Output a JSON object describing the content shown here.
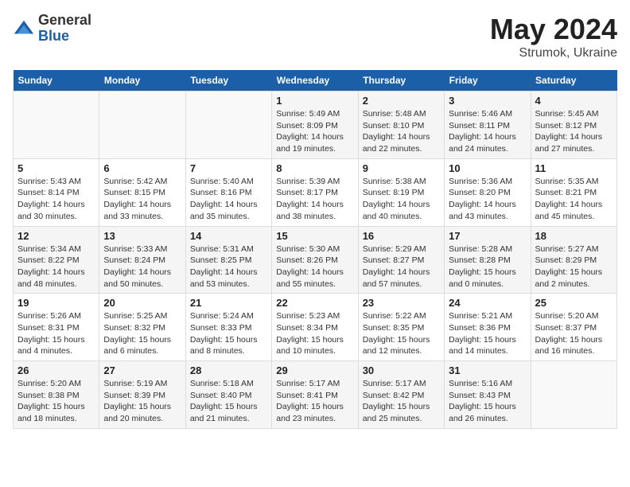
{
  "logo": {
    "general": "General",
    "blue": "Blue"
  },
  "title": {
    "month_year": "May 2024",
    "location": "Strumok, Ukraine"
  },
  "weekdays": [
    "Sunday",
    "Monday",
    "Tuesday",
    "Wednesday",
    "Thursday",
    "Friday",
    "Saturday"
  ],
  "weeks": [
    [
      {
        "day": "",
        "info": ""
      },
      {
        "day": "",
        "info": ""
      },
      {
        "day": "",
        "info": ""
      },
      {
        "day": "1",
        "info": "Sunrise: 5:49 AM\nSunset: 8:09 PM\nDaylight: 14 hours\nand 19 minutes."
      },
      {
        "day": "2",
        "info": "Sunrise: 5:48 AM\nSunset: 8:10 PM\nDaylight: 14 hours\nand 22 minutes."
      },
      {
        "day": "3",
        "info": "Sunrise: 5:46 AM\nSunset: 8:11 PM\nDaylight: 14 hours\nand 24 minutes."
      },
      {
        "day": "4",
        "info": "Sunrise: 5:45 AM\nSunset: 8:12 PM\nDaylight: 14 hours\nand 27 minutes."
      }
    ],
    [
      {
        "day": "5",
        "info": "Sunrise: 5:43 AM\nSunset: 8:14 PM\nDaylight: 14 hours\nand 30 minutes."
      },
      {
        "day": "6",
        "info": "Sunrise: 5:42 AM\nSunset: 8:15 PM\nDaylight: 14 hours\nand 33 minutes."
      },
      {
        "day": "7",
        "info": "Sunrise: 5:40 AM\nSunset: 8:16 PM\nDaylight: 14 hours\nand 35 minutes."
      },
      {
        "day": "8",
        "info": "Sunrise: 5:39 AM\nSunset: 8:17 PM\nDaylight: 14 hours\nand 38 minutes."
      },
      {
        "day": "9",
        "info": "Sunrise: 5:38 AM\nSunset: 8:19 PM\nDaylight: 14 hours\nand 40 minutes."
      },
      {
        "day": "10",
        "info": "Sunrise: 5:36 AM\nSunset: 8:20 PM\nDaylight: 14 hours\nand 43 minutes."
      },
      {
        "day": "11",
        "info": "Sunrise: 5:35 AM\nSunset: 8:21 PM\nDaylight: 14 hours\nand 45 minutes."
      }
    ],
    [
      {
        "day": "12",
        "info": "Sunrise: 5:34 AM\nSunset: 8:22 PM\nDaylight: 14 hours\nand 48 minutes."
      },
      {
        "day": "13",
        "info": "Sunrise: 5:33 AM\nSunset: 8:24 PM\nDaylight: 14 hours\nand 50 minutes."
      },
      {
        "day": "14",
        "info": "Sunrise: 5:31 AM\nSunset: 8:25 PM\nDaylight: 14 hours\nand 53 minutes."
      },
      {
        "day": "15",
        "info": "Sunrise: 5:30 AM\nSunset: 8:26 PM\nDaylight: 14 hours\nand 55 minutes."
      },
      {
        "day": "16",
        "info": "Sunrise: 5:29 AM\nSunset: 8:27 PM\nDaylight: 14 hours\nand 57 minutes."
      },
      {
        "day": "17",
        "info": "Sunrise: 5:28 AM\nSunset: 8:28 PM\nDaylight: 15 hours\nand 0 minutes."
      },
      {
        "day": "18",
        "info": "Sunrise: 5:27 AM\nSunset: 8:29 PM\nDaylight: 15 hours\nand 2 minutes."
      }
    ],
    [
      {
        "day": "19",
        "info": "Sunrise: 5:26 AM\nSunset: 8:31 PM\nDaylight: 15 hours\nand 4 minutes."
      },
      {
        "day": "20",
        "info": "Sunrise: 5:25 AM\nSunset: 8:32 PM\nDaylight: 15 hours\nand 6 minutes."
      },
      {
        "day": "21",
        "info": "Sunrise: 5:24 AM\nSunset: 8:33 PM\nDaylight: 15 hours\nand 8 minutes."
      },
      {
        "day": "22",
        "info": "Sunrise: 5:23 AM\nSunset: 8:34 PM\nDaylight: 15 hours\nand 10 minutes."
      },
      {
        "day": "23",
        "info": "Sunrise: 5:22 AM\nSunset: 8:35 PM\nDaylight: 15 hours\nand 12 minutes."
      },
      {
        "day": "24",
        "info": "Sunrise: 5:21 AM\nSunset: 8:36 PM\nDaylight: 15 hours\nand 14 minutes."
      },
      {
        "day": "25",
        "info": "Sunrise: 5:20 AM\nSunset: 8:37 PM\nDaylight: 15 hours\nand 16 minutes."
      }
    ],
    [
      {
        "day": "26",
        "info": "Sunrise: 5:20 AM\nSunset: 8:38 PM\nDaylight: 15 hours\nand 18 minutes."
      },
      {
        "day": "27",
        "info": "Sunrise: 5:19 AM\nSunset: 8:39 PM\nDaylight: 15 hours\nand 20 minutes."
      },
      {
        "day": "28",
        "info": "Sunrise: 5:18 AM\nSunset: 8:40 PM\nDaylight: 15 hours\nand 21 minutes."
      },
      {
        "day": "29",
        "info": "Sunrise: 5:17 AM\nSunset: 8:41 PM\nDaylight: 15 hours\nand 23 minutes."
      },
      {
        "day": "30",
        "info": "Sunrise: 5:17 AM\nSunset: 8:42 PM\nDaylight: 15 hours\nand 25 minutes."
      },
      {
        "day": "31",
        "info": "Sunrise: 5:16 AM\nSunset: 8:43 PM\nDaylight: 15 hours\nand 26 minutes."
      },
      {
        "day": "",
        "info": ""
      }
    ]
  ]
}
